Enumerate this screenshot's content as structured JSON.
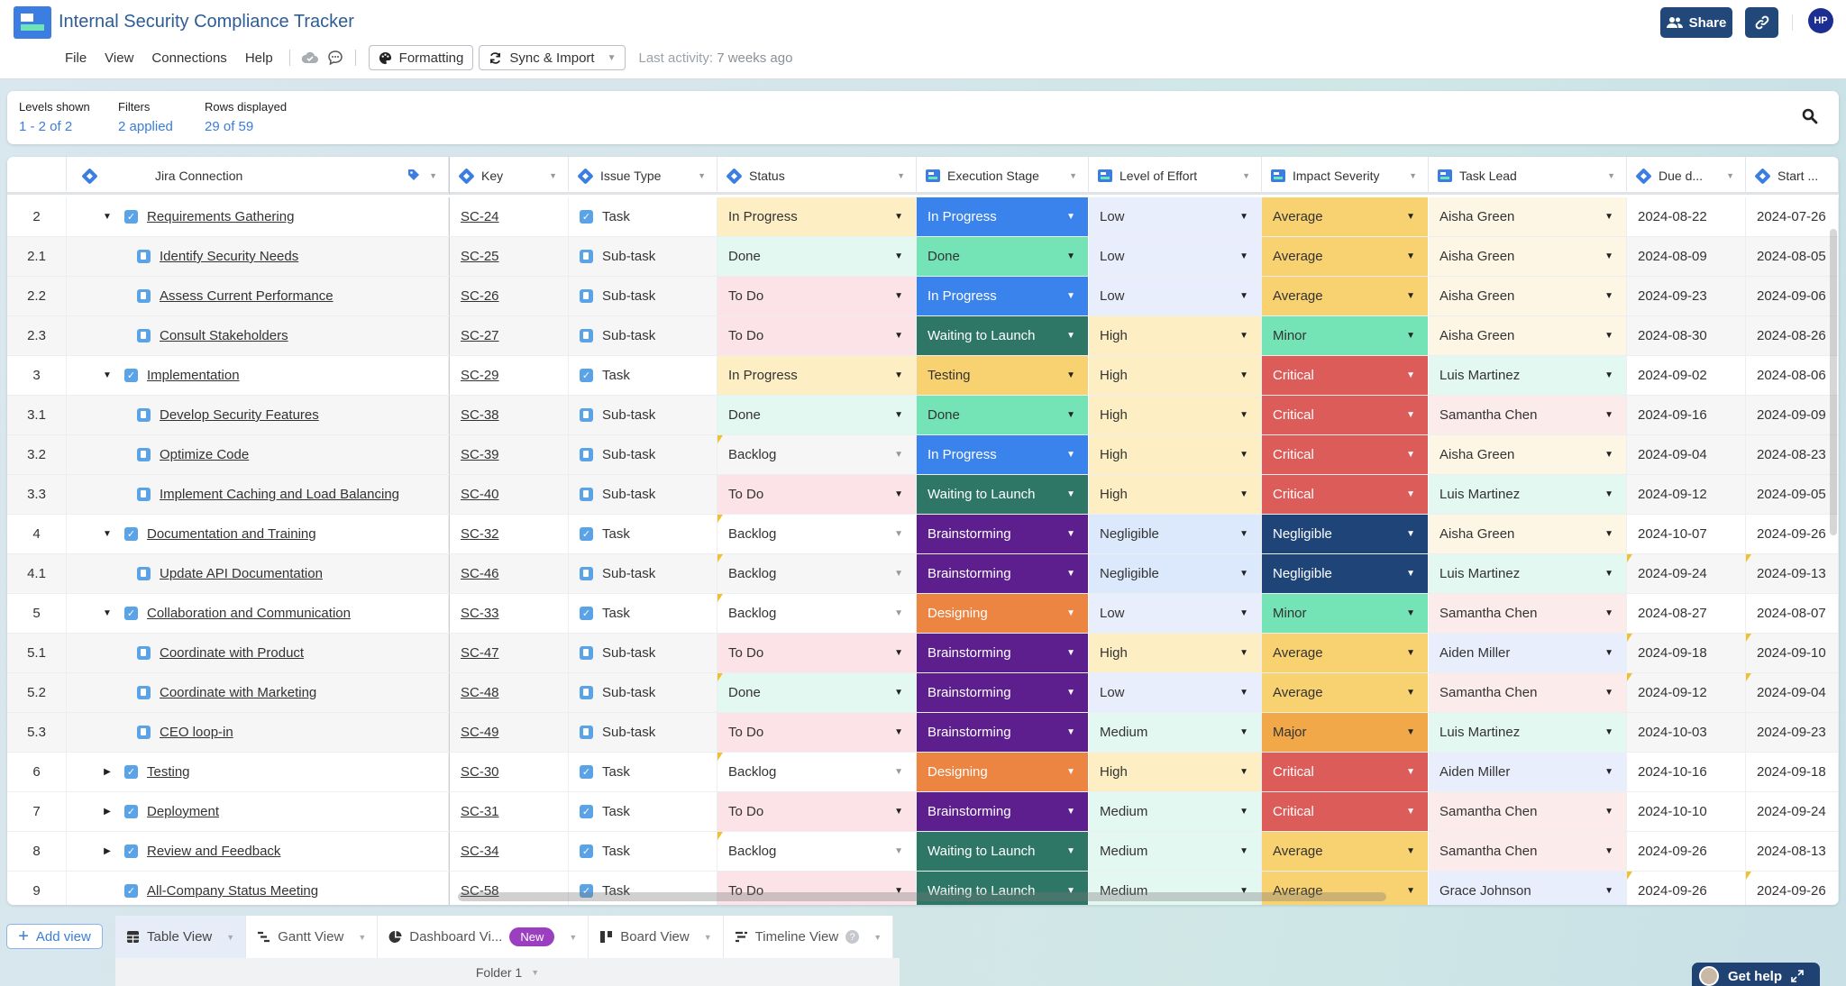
{
  "app": {
    "title": "Internal Security Compliance Tracker",
    "menu": [
      "File",
      "View",
      "Connections",
      "Help"
    ],
    "formatting_label": "Formatting",
    "sync_label": "Sync & Import",
    "last_activity_label": "Last activity:",
    "last_activity_value": "7 weeks ago",
    "share_label": "Share",
    "avatar_initials": "HP"
  },
  "filters": {
    "levels_label": "Levels shown",
    "levels_value": "1 - 2 of 2",
    "filters_label": "Filters",
    "filters_value": "2 applied",
    "rows_label": "Rows displayed",
    "rows_value": "29 of 59"
  },
  "columns": {
    "name": "Jira Connection",
    "key": "Key",
    "type": "Issue Type",
    "status": "Status",
    "stage": "Execution Stage",
    "effort": "Level of Effort",
    "impact": "Impact Severity",
    "lead": "Task Lead",
    "due": "Due d...",
    "start": "Start ..."
  },
  "colors": {
    "status": {
      "In Progress": "#fdeec3",
      "Done": "#e3f8f0",
      "To Do": "#fbe3e8",
      "Backlog": "transparent"
    },
    "stage": {
      "In Progress": "#3a82ec",
      "Done": "#74e3b5",
      "Waiting to Launch": "#2e7666",
      "Testing": "#f8d270",
      "Brainstorming": "#5e1f8e",
      "Designing": "#ec8442"
    },
    "effort": {
      "Low": "#e8eefb",
      "High": "#fdeec3",
      "Negligible": "#dce8fb",
      "Medium": "#e3f8f0"
    },
    "impact": {
      "Average": "#f8d270",
      "Minor": "#74e3b5",
      "Critical": "#dc5c5a",
      "Negligible": "#1f4578",
      "Major": "#f0a849"
    },
    "lead": {
      "Aisha Green": "#fdf6e4",
      "Luis Martinez": "#e3f8f0",
      "Samantha Chen": "#fcebeb",
      "Aiden Miller": "#e8eefb",
      "Grace Johnson": "#e8eefb"
    }
  },
  "rows": [
    {
      "num": "2",
      "level": 1,
      "expand": "down",
      "name": "Requirements Gathering",
      "key": "SC-24",
      "type": "Task",
      "status": "In Progress",
      "stage": "In Progress",
      "effort": "Low",
      "impact": "Average",
      "lead": "Aisha Green",
      "due": "2024-08-22",
      "start": "2024-07-26"
    },
    {
      "num": "2.1",
      "level": 2,
      "name": "Identify Security Needs",
      "key": "SC-25",
      "type": "Sub-task",
      "status": "Done",
      "stage": "Done",
      "effort": "Low",
      "impact": "Average",
      "lead": "Aisha Green",
      "due": "2024-08-09",
      "start": "2024-08-05"
    },
    {
      "num": "2.2",
      "level": 2,
      "name": "Assess Current Performance",
      "key": "SC-26",
      "type": "Sub-task",
      "status": "To Do",
      "stage": "In Progress",
      "effort": "Low",
      "impact": "Average",
      "lead": "Aisha Green",
      "due": "2024-09-23",
      "start": "2024-09-06"
    },
    {
      "num": "2.3",
      "level": 2,
      "name": "Consult Stakeholders",
      "key": "SC-27",
      "type": "Sub-task",
      "status": "To Do",
      "stage": "Waiting to Launch",
      "effort": "High",
      "impact": "Minor",
      "lead": "Aisha Green",
      "due": "2024-08-30",
      "start": "2024-08-26"
    },
    {
      "num": "3",
      "level": 1,
      "expand": "down",
      "name": "Implementation",
      "key": "SC-29",
      "type": "Task",
      "status": "In Progress",
      "stage": "Testing",
      "effort": "High",
      "impact": "Critical",
      "lead": "Luis Martinez",
      "due": "2024-09-02",
      "start": "2024-08-06"
    },
    {
      "num": "3.1",
      "level": 2,
      "name": "Develop Security Features",
      "key": "SC-38",
      "type": "Sub-task",
      "status": "Done",
      "stage": "Done",
      "effort": "High",
      "impact": "Critical",
      "lead": "Samantha Chen",
      "due": "2024-09-16",
      "start": "2024-09-09"
    },
    {
      "num": "3.2",
      "level": 2,
      "name": "Optimize Code",
      "key": "SC-39",
      "type": "Sub-task",
      "status": "Backlog",
      "status_flag": true,
      "stage": "In Progress",
      "effort": "High",
      "impact": "Critical",
      "lead": "Aisha Green",
      "due": "2024-09-04",
      "start": "2024-08-23"
    },
    {
      "num": "3.3",
      "level": 2,
      "name": "Implement Caching and Load Balancing",
      "key": "SC-40",
      "type": "Sub-task",
      "status": "To Do",
      "stage": "Waiting to Launch",
      "effort": "High",
      "impact": "Critical",
      "lead": "Luis Martinez",
      "due": "2024-09-12",
      "start": "2024-09-05"
    },
    {
      "num": "4",
      "level": 1,
      "expand": "down",
      "name": "Documentation and Training",
      "key": "SC-32",
      "type": "Task",
      "status": "Backlog",
      "status_flag": true,
      "stage": "Brainstorming",
      "effort": "Negligible",
      "impact": "Negligible",
      "lead": "Aisha Green",
      "due": "2024-10-07",
      "start": "2024-09-26"
    },
    {
      "num": "4.1",
      "level": 2,
      "name": "Update API Documentation",
      "key": "SC-46",
      "type": "Sub-task",
      "status": "Backlog",
      "status_flag": true,
      "stage": "Brainstorming",
      "effort": "Negligible",
      "impact": "Negligible",
      "lead": "Luis Martinez",
      "due": "2024-09-24",
      "start": "2024-09-13",
      "date_flag": true
    },
    {
      "num": "5",
      "level": 1,
      "expand": "down",
      "name": "Collaboration and Communication",
      "key": "SC-33",
      "type": "Task",
      "status": "Backlog",
      "status_flag": true,
      "stage": "Designing",
      "effort": "Low",
      "impact": "Minor",
      "lead": "Samantha Chen",
      "due": "2024-08-27",
      "start": "2024-08-07"
    },
    {
      "num": "5.1",
      "level": 2,
      "name": "Coordinate with Product",
      "key": "SC-47",
      "type": "Sub-task",
      "status": "To Do",
      "stage": "Brainstorming",
      "effort": "High",
      "impact": "Average",
      "lead": "Aiden Miller",
      "due": "2024-09-18",
      "start": "2024-09-10",
      "date_flag": true
    },
    {
      "num": "5.2",
      "level": 2,
      "name": "Coordinate with Marketing",
      "key": "SC-48",
      "type": "Sub-task",
      "status": "Done",
      "status_flag": true,
      "stage": "Brainstorming",
      "effort": "Low",
      "impact": "Average",
      "lead": "Samantha Chen",
      "due": "2024-09-12",
      "start": "2024-09-04",
      "date_flag": true
    },
    {
      "num": "5.3",
      "level": 2,
      "name": "CEO loop-in",
      "key": "SC-49",
      "type": "Sub-task",
      "status": "To Do",
      "stage": "Brainstorming",
      "effort": "Medium",
      "impact": "Major",
      "lead": "Luis Martinez",
      "due": "2024-10-03",
      "start": "2024-09-23"
    },
    {
      "num": "6",
      "level": 1,
      "expand": "right",
      "name": "Testing",
      "key": "SC-30",
      "type": "Task",
      "status": "Backlog",
      "status_flag": true,
      "stage": "Designing",
      "effort": "High",
      "impact": "Critical",
      "lead": "Aiden Miller",
      "due": "2024-10-16",
      "start": "2024-09-18"
    },
    {
      "num": "7",
      "level": 1,
      "expand": "right",
      "name": "Deployment",
      "key": "SC-31",
      "type": "Task",
      "status": "To Do",
      "stage": "Brainstorming",
      "effort": "Medium",
      "impact": "Critical",
      "lead": "Samantha Chen",
      "due": "2024-10-10",
      "start": "2024-09-24"
    },
    {
      "num": "8",
      "level": 1,
      "expand": "right",
      "name": "Review and Feedback",
      "key": "SC-34",
      "type": "Task",
      "status": "Backlog",
      "status_flag": true,
      "stage": "Waiting to Launch",
      "effort": "Medium",
      "impact": "Average",
      "lead": "Samantha Chen",
      "due": "2024-09-26",
      "start": "2024-08-13"
    },
    {
      "num": "9",
      "level": 1,
      "expand": "none",
      "name": "All-Company Status Meeting",
      "key": "SC-58",
      "type": "Task",
      "status": "To Do",
      "stage": "Waiting to Launch",
      "effort": "Medium",
      "impact": "Average",
      "lead": "Grace Johnson",
      "due": "2024-09-26",
      "start": "2024-09-26",
      "date_flag": true
    }
  ],
  "bottom": {
    "add_view_label": "Add view",
    "tabs": [
      {
        "label": "Table View",
        "icon": "table-icon",
        "active": true
      },
      {
        "label": "Gantt View",
        "icon": "gantt-icon"
      },
      {
        "label": "Dashboard Vi...",
        "icon": "dashboard-icon",
        "badge": "New"
      },
      {
        "label": "Board View",
        "icon": "board-icon"
      },
      {
        "label": "Timeline View",
        "icon": "timeline-icon",
        "help": "?"
      }
    ],
    "folder_label": "Folder 1",
    "get_help_label": "Get help"
  }
}
